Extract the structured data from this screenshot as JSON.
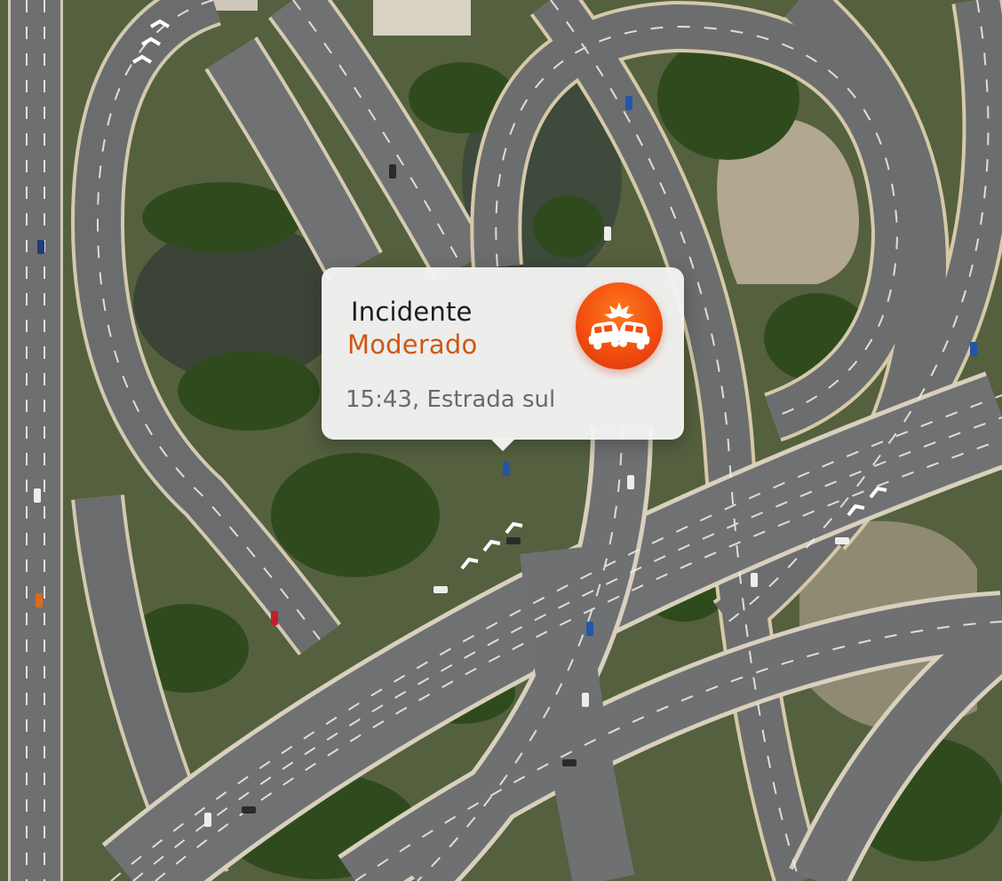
{
  "incident": {
    "title": "Incidente",
    "severity": "Moderado",
    "time": "15:43",
    "location": "Estrada sul",
    "details": "15:43, Estrada sul",
    "icon": "car-collision-icon",
    "accent_color": "#f24e10",
    "severity_color": "#cf5614"
  }
}
